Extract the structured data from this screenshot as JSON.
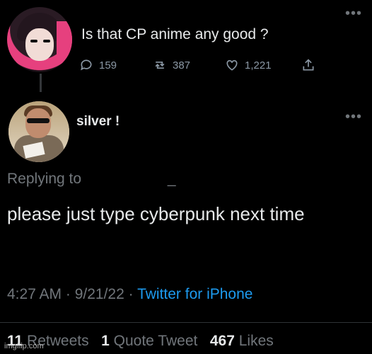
{
  "tweet1": {
    "text": "Is that CP anime any good ?",
    "replies": "159",
    "retweets": "387",
    "likes": "1,221",
    "more_label": "•••"
  },
  "tweet2": {
    "display_name": "silver !",
    "more_label": "•••",
    "replying_to": "Replying to",
    "replying_handle_suffix": "_",
    "body": "please just type cyberpunk next time",
    "time": "4:27 AM · 9/21/22 · ",
    "source": "Twitter for iPhone",
    "retweet_count": "11",
    "retweet_label": "Retweets",
    "quote_count": "1",
    "quote_label": "Quote Tweet",
    "like_count": "467",
    "like_label": "Likes"
  },
  "watermark": "imgflip.com",
  "colors": {
    "background": "#000000",
    "link": "#1d9bf0",
    "muted": "#71767b"
  }
}
